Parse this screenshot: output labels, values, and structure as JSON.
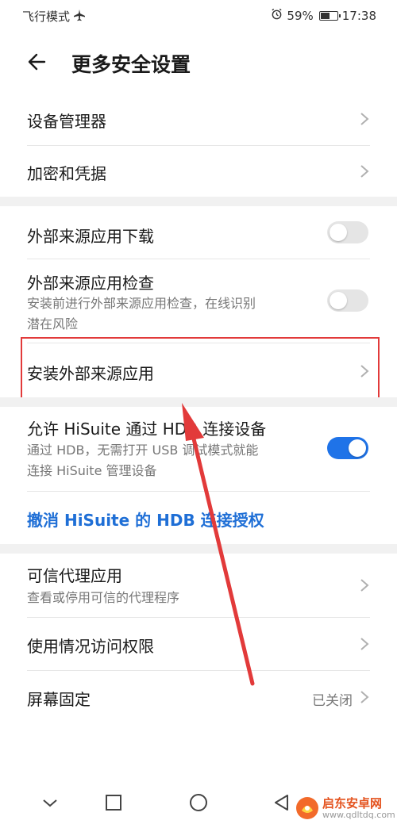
{
  "status_bar": {
    "mode": "飞行模式",
    "battery_percent": "59%",
    "battery_level": 0.59,
    "time": "17:38"
  },
  "header": {
    "title": "更多安全设置"
  },
  "items": {
    "device_admin": {
      "title": "设备管理器"
    },
    "encryption": {
      "title": "加密和凭据"
    },
    "external_download": {
      "title": "外部来源应用下载",
      "toggle": "off"
    },
    "external_check": {
      "title": "外部来源应用检查",
      "subtitle_line1": "安装前进行外部来源应用检查，在线识别",
      "subtitle_line2": "潜在风险",
      "toggle": "off"
    },
    "install_external": {
      "title": "安装外部来源应用"
    },
    "hisuite_hdb": {
      "title": "允许 HiSuite 通过 HDB 连接设备",
      "subtitle_line1": "通过 HDB，无需打开 USB 调试模式就能",
      "subtitle_line2": "连接 HiSuite 管理设备",
      "toggle": "on"
    },
    "revoke_hisuite": {
      "title": "撤消 HiSuite 的 HDB 连接授权"
    },
    "trust_agents": {
      "title": "可信代理应用",
      "subtitle": "查看或停用可信的代理程序"
    },
    "usage_access": {
      "title": "使用情况访问权限"
    },
    "screen_pinning": {
      "title": "屏幕固定",
      "value": "已关闭"
    }
  },
  "watermark": {
    "name": "启东安卓网",
    "url": "www.qdltdq.com"
  },
  "colors": {
    "accent": "#1f73e8",
    "link": "#1f6fd6",
    "highlight": "#e23a3a"
  }
}
